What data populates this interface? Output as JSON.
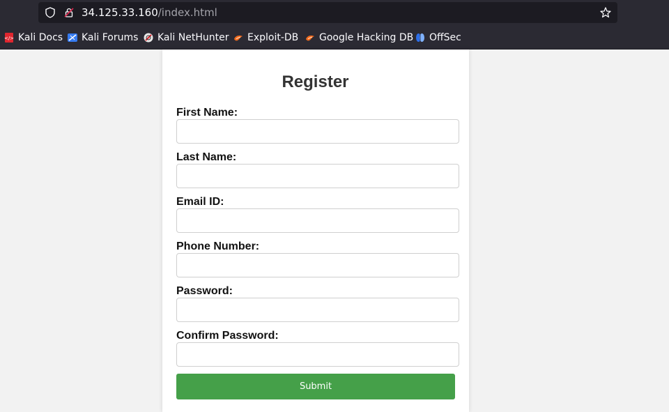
{
  "browser": {
    "url_host": "34.125.33.160",
    "url_path": "/index.html",
    "bookmarks": [
      {
        "label": "Kali Docs",
        "icon": "kali-docs-icon"
      },
      {
        "label": "Kali Forums",
        "icon": "kali-forums-icon"
      },
      {
        "label": "Kali NetHunter",
        "icon": "kali-nethunter-icon"
      },
      {
        "label": "Exploit-DB",
        "icon": "exploit-db-icon"
      },
      {
        "label": "Google Hacking DB",
        "icon": "google-hacking-db-icon"
      },
      {
        "label": "OffSec",
        "icon": "offsec-icon"
      }
    ]
  },
  "form": {
    "title": "Register",
    "fields": [
      {
        "label": "First Name:",
        "value": ""
      },
      {
        "label": "Last Name:",
        "value": ""
      },
      {
        "label": "Email ID:",
        "value": ""
      },
      {
        "label": "Phone Number:",
        "value": ""
      },
      {
        "label": "Password:",
        "value": ""
      },
      {
        "label": "Confirm Password:",
        "value": ""
      }
    ],
    "submit_label": "Submit"
  },
  "colors": {
    "chrome_bg": "#2b2a33",
    "urlbar_bg": "#1c1b22",
    "page_bg": "#f2f2f2",
    "submit_bg": "#45a049"
  }
}
